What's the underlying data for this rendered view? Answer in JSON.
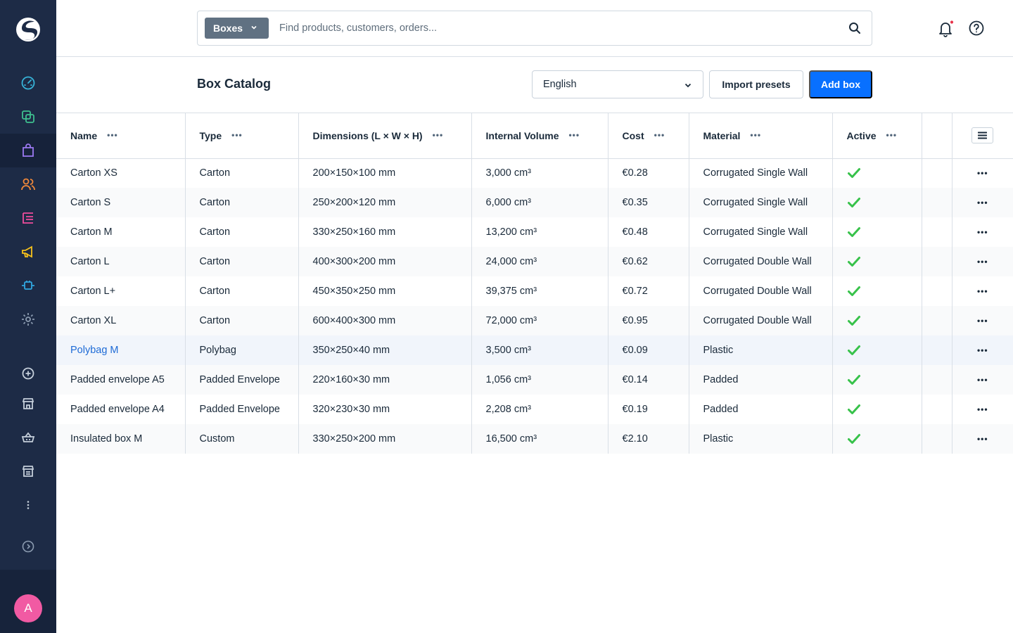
{
  "sidebar": {
    "logo_icon": "shopware-logo",
    "items": [
      {
        "name": "dashboard",
        "icon": "gauge-icon",
        "color": "#37b4d9"
      },
      {
        "name": "catalogues",
        "icon": "copy-icon",
        "color": "#3ec08f"
      },
      {
        "name": "orders",
        "icon": "shopping-bag-icon",
        "color": "#9c79f2"
      },
      {
        "name": "customers",
        "icon": "users-icon",
        "color": "#f0883a"
      },
      {
        "name": "content",
        "icon": "list-icon",
        "color": "#ef4d9d"
      },
      {
        "name": "marketing",
        "icon": "megaphone-icon",
        "color": "#f7c21b"
      },
      {
        "name": "extensions",
        "icon": "plug-icon",
        "color": "#30a7e0"
      },
      {
        "name": "settings",
        "icon": "gear-icon",
        "color": "#8b9bb0"
      },
      {
        "name": "add",
        "icon": "plus-circle-icon",
        "color": "#c5cfda"
      },
      {
        "name": "storefront",
        "icon": "shop-icon",
        "color": "#c5cfda"
      },
      {
        "name": "basket",
        "icon": "basket-icon",
        "color": "#c5cfda"
      },
      {
        "name": "store",
        "icon": "store-icon",
        "color": "#c5cfda"
      },
      {
        "name": "more",
        "icon": "more-vertical-icon",
        "color": "#c5cfda"
      },
      {
        "name": "expand",
        "icon": "chevron-circle-icon",
        "color": "#8b9bb0"
      }
    ],
    "avatar_initial": "A",
    "avatar_color": "#f15aa3"
  },
  "search": {
    "scope_label": "Boxes",
    "placeholder": "Find products, customers, orders..."
  },
  "page": {
    "title": "Box Catalog",
    "language": "English",
    "import_label": "Import presets",
    "add_label": "Add box",
    "accent_color": "#0870ff"
  },
  "table": {
    "columns": [
      "Name",
      "Type",
      "Dimensions (L × W × H)",
      "Internal Volume",
      "Cost",
      "Material",
      "Active"
    ],
    "rows": [
      {
        "name": "Carton XS",
        "type": "Carton",
        "dims": "200×150×100 mm",
        "volume": "3,000 cm³",
        "cost": "€0.28",
        "material": "Corrugated Single Wall",
        "active": true
      },
      {
        "name": "Carton S",
        "type": "Carton",
        "dims": "250×200×120 mm",
        "volume": "6,000 cm³",
        "cost": "€0.35",
        "material": "Corrugated Single Wall",
        "active": true
      },
      {
        "name": "Carton M",
        "type": "Carton",
        "dims": "330×250×160 mm",
        "volume": "13,200 cm³",
        "cost": "€0.48",
        "material": "Corrugated Single Wall",
        "active": true
      },
      {
        "name": "Carton L",
        "type": "Carton",
        "dims": "400×300×200 mm",
        "volume": "24,000 cm³",
        "cost": "€0.62",
        "material": "Corrugated Double Wall",
        "active": true
      },
      {
        "name": "Carton L+",
        "type": "Carton",
        "dims": "450×350×250 mm",
        "volume": "39,375 cm³",
        "cost": "€0.72",
        "material": "Corrugated Double Wall",
        "active": true
      },
      {
        "name": "Carton XL",
        "type": "Carton",
        "dims": "600×400×300 mm",
        "volume": "72,000 cm³",
        "cost": "€0.95",
        "material": "Corrugated Double Wall",
        "active": true
      },
      {
        "name": "Polybag M",
        "type": "Polybag",
        "dims": "350×250×40 mm",
        "volume": "3,500 cm³",
        "cost": "€0.09",
        "material": "Plastic",
        "active": true,
        "highlighted": true
      },
      {
        "name": "Padded envelope A5",
        "type": "Padded Envelope",
        "dims": "220×160×30 mm",
        "volume": "1,056 cm³",
        "cost": "€0.14",
        "material": "Padded",
        "active": true
      },
      {
        "name": "Padded envelope A4",
        "type": "Padded Envelope",
        "dims": "320×230×30 mm",
        "volume": "2,208 cm³",
        "cost": "€0.19",
        "material": "Padded",
        "active": true
      },
      {
        "name": "Insulated box M",
        "type": "Custom",
        "dims": "330×250×200 mm",
        "volume": "16,500 cm³",
        "cost": "€2.10",
        "material": "Plastic",
        "active": true
      }
    ],
    "check_color": "#37c24a"
  }
}
